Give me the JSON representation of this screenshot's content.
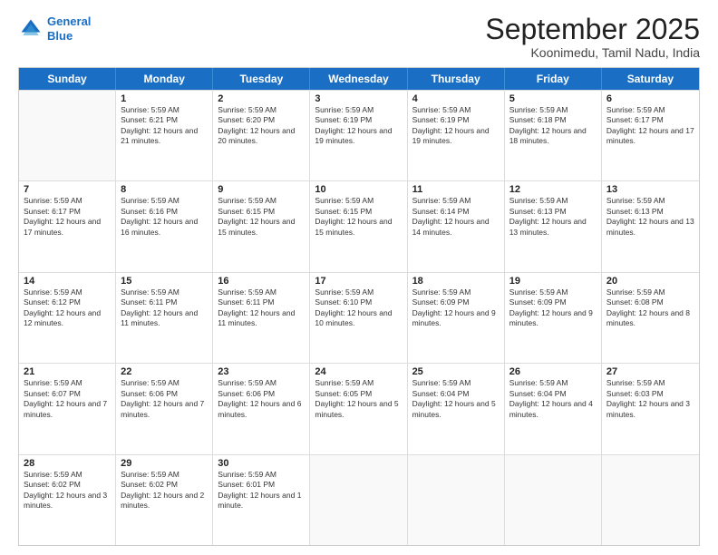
{
  "logo": {
    "line1": "General",
    "line2": "Blue"
  },
  "header": {
    "month": "September 2025",
    "location": "Koonimedu, Tamil Nadu, India"
  },
  "days": [
    "Sunday",
    "Monday",
    "Tuesday",
    "Wednesday",
    "Thursday",
    "Friday",
    "Saturday"
  ],
  "weeks": [
    [
      {
        "day": "",
        "sunrise": "",
        "sunset": "",
        "daylight": ""
      },
      {
        "day": "1",
        "sunrise": "Sunrise: 5:59 AM",
        "sunset": "Sunset: 6:21 PM",
        "daylight": "Daylight: 12 hours and 21 minutes."
      },
      {
        "day": "2",
        "sunrise": "Sunrise: 5:59 AM",
        "sunset": "Sunset: 6:20 PM",
        "daylight": "Daylight: 12 hours and 20 minutes."
      },
      {
        "day": "3",
        "sunrise": "Sunrise: 5:59 AM",
        "sunset": "Sunset: 6:19 PM",
        "daylight": "Daylight: 12 hours and 19 minutes."
      },
      {
        "day": "4",
        "sunrise": "Sunrise: 5:59 AM",
        "sunset": "Sunset: 6:19 PM",
        "daylight": "Daylight: 12 hours and 19 minutes."
      },
      {
        "day": "5",
        "sunrise": "Sunrise: 5:59 AM",
        "sunset": "Sunset: 6:18 PM",
        "daylight": "Daylight: 12 hours and 18 minutes."
      },
      {
        "day": "6",
        "sunrise": "Sunrise: 5:59 AM",
        "sunset": "Sunset: 6:17 PM",
        "daylight": "Daylight: 12 hours and 17 minutes."
      }
    ],
    [
      {
        "day": "7",
        "sunrise": "Sunrise: 5:59 AM",
        "sunset": "Sunset: 6:17 PM",
        "daylight": "Daylight: 12 hours and 17 minutes."
      },
      {
        "day": "8",
        "sunrise": "Sunrise: 5:59 AM",
        "sunset": "Sunset: 6:16 PM",
        "daylight": "Daylight: 12 hours and 16 minutes."
      },
      {
        "day": "9",
        "sunrise": "Sunrise: 5:59 AM",
        "sunset": "Sunset: 6:15 PM",
        "daylight": "Daylight: 12 hours and 15 minutes."
      },
      {
        "day": "10",
        "sunrise": "Sunrise: 5:59 AM",
        "sunset": "Sunset: 6:15 PM",
        "daylight": "Daylight: 12 hours and 15 minutes."
      },
      {
        "day": "11",
        "sunrise": "Sunrise: 5:59 AM",
        "sunset": "Sunset: 6:14 PM",
        "daylight": "Daylight: 12 hours and 14 minutes."
      },
      {
        "day": "12",
        "sunrise": "Sunrise: 5:59 AM",
        "sunset": "Sunset: 6:13 PM",
        "daylight": "Daylight: 12 hours and 13 minutes."
      },
      {
        "day": "13",
        "sunrise": "Sunrise: 5:59 AM",
        "sunset": "Sunset: 6:13 PM",
        "daylight": "Daylight: 12 hours and 13 minutes."
      }
    ],
    [
      {
        "day": "14",
        "sunrise": "Sunrise: 5:59 AM",
        "sunset": "Sunset: 6:12 PM",
        "daylight": "Daylight: 12 hours and 12 minutes."
      },
      {
        "day": "15",
        "sunrise": "Sunrise: 5:59 AM",
        "sunset": "Sunset: 6:11 PM",
        "daylight": "Daylight: 12 hours and 11 minutes."
      },
      {
        "day": "16",
        "sunrise": "Sunrise: 5:59 AM",
        "sunset": "Sunset: 6:11 PM",
        "daylight": "Daylight: 12 hours and 11 minutes."
      },
      {
        "day": "17",
        "sunrise": "Sunrise: 5:59 AM",
        "sunset": "Sunset: 6:10 PM",
        "daylight": "Daylight: 12 hours and 10 minutes."
      },
      {
        "day": "18",
        "sunrise": "Sunrise: 5:59 AM",
        "sunset": "Sunset: 6:09 PM",
        "daylight": "Daylight: 12 hours and 9 minutes."
      },
      {
        "day": "19",
        "sunrise": "Sunrise: 5:59 AM",
        "sunset": "Sunset: 6:09 PM",
        "daylight": "Daylight: 12 hours and 9 minutes."
      },
      {
        "day": "20",
        "sunrise": "Sunrise: 5:59 AM",
        "sunset": "Sunset: 6:08 PM",
        "daylight": "Daylight: 12 hours and 8 minutes."
      }
    ],
    [
      {
        "day": "21",
        "sunrise": "Sunrise: 5:59 AM",
        "sunset": "Sunset: 6:07 PM",
        "daylight": "Daylight: 12 hours and 7 minutes."
      },
      {
        "day": "22",
        "sunrise": "Sunrise: 5:59 AM",
        "sunset": "Sunset: 6:06 PM",
        "daylight": "Daylight: 12 hours and 7 minutes."
      },
      {
        "day": "23",
        "sunrise": "Sunrise: 5:59 AM",
        "sunset": "Sunset: 6:06 PM",
        "daylight": "Daylight: 12 hours and 6 minutes."
      },
      {
        "day": "24",
        "sunrise": "Sunrise: 5:59 AM",
        "sunset": "Sunset: 6:05 PM",
        "daylight": "Daylight: 12 hours and 5 minutes."
      },
      {
        "day": "25",
        "sunrise": "Sunrise: 5:59 AM",
        "sunset": "Sunset: 6:04 PM",
        "daylight": "Daylight: 12 hours and 5 minutes."
      },
      {
        "day": "26",
        "sunrise": "Sunrise: 5:59 AM",
        "sunset": "Sunset: 6:04 PM",
        "daylight": "Daylight: 12 hours and 4 minutes."
      },
      {
        "day": "27",
        "sunrise": "Sunrise: 5:59 AM",
        "sunset": "Sunset: 6:03 PM",
        "daylight": "Daylight: 12 hours and 3 minutes."
      }
    ],
    [
      {
        "day": "28",
        "sunrise": "Sunrise: 5:59 AM",
        "sunset": "Sunset: 6:02 PM",
        "daylight": "Daylight: 12 hours and 3 minutes."
      },
      {
        "day": "29",
        "sunrise": "Sunrise: 5:59 AM",
        "sunset": "Sunset: 6:02 PM",
        "daylight": "Daylight: 12 hours and 2 minutes."
      },
      {
        "day": "30",
        "sunrise": "Sunrise: 5:59 AM",
        "sunset": "Sunset: 6:01 PM",
        "daylight": "Daylight: 12 hours and 1 minute."
      },
      {
        "day": "",
        "sunrise": "",
        "sunset": "",
        "daylight": ""
      },
      {
        "day": "",
        "sunrise": "",
        "sunset": "",
        "daylight": ""
      },
      {
        "day": "",
        "sunrise": "",
        "sunset": "",
        "daylight": ""
      },
      {
        "day": "",
        "sunrise": "",
        "sunset": "",
        "daylight": ""
      }
    ]
  ]
}
